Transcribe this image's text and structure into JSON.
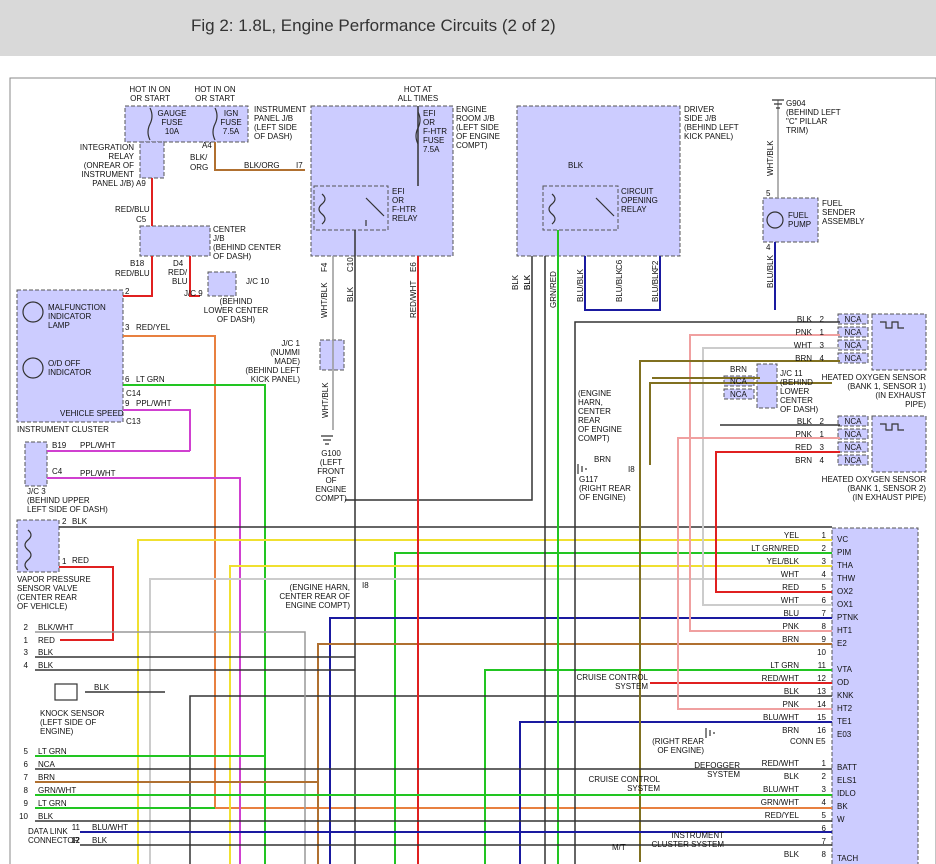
{
  "header": {
    "title": "Fig 2: 1.8L, Engine Performance Circuits (2 of 2)"
  },
  "labels": [
    [
      "HOT IN ON OR START",
      "HOT IN ON OR START",
      "GAUGE FUSE 10A",
      "IGN FUSE 7.5A",
      "INSTRUMENT PANEL J/B (LEFT SIDE OF DASH)"
    ]
  ],
  "texts": {
    "hot_on_start_1": [
      "HOT IN ON",
      "OR START"
    ],
    "hot_on_start_2": [
      "HOT IN ON",
      "OR START"
    ],
    "gauge_fuse": [
      "GAUGE",
      "FUSE",
      "10A"
    ],
    "ign_fuse": [
      "IGN",
      "FUSE",
      "7.5A"
    ],
    "ipjb": [
      "INSTRUMENT",
      "PANEL J/B",
      "(LEFT SIDE",
      "OF DASH)"
    ],
    "hot_all_times": [
      "HOT AT",
      "ALL TIMES"
    ],
    "efi_fuse": [
      "EFI",
      "OR",
      "F-HTR",
      "FUSE",
      "7.5A"
    ],
    "erjb": [
      "ENGINE",
      "ROOM J/B",
      "(LEFT SIDE",
      "OF ENGINE",
      "COMPT)"
    ],
    "dsjb": [
      "DRIVER",
      "SIDE J/B",
      "(BEHIND LEFT",
      "KICK PANEL)"
    ],
    "g904": [
      "G904",
      "(BEHIND LEFT",
      "\"C\" PILLAR",
      "TRIM)"
    ],
    "integration_relay": [
      "INTEGRATION",
      "RELAY",
      "(ONREAR OF",
      "INSTRUMENT",
      "PANEL J/B)"
    ],
    "center_jb": [
      "CENTER",
      "J/B",
      "(BEHIND CENTER",
      "OF DASH)"
    ],
    "jc9": [
      "(BEHIND",
      "LOWER CENTER",
      "OF DASH)"
    ],
    "efi_relay": [
      "EFI",
      "OR",
      "F-HTR",
      "RELAY"
    ],
    "cor_relay": [
      "CIRCUIT",
      "OPENING",
      "RELAY"
    ],
    "fuel_pump": [
      "FUEL",
      "PUMP"
    ],
    "fuel_sender": [
      "FUEL",
      "SENDER",
      "ASSEMBLY"
    ],
    "malfunction_lamp": [
      "MALFUNCTION",
      "INDICATOR",
      "LAMP"
    ],
    "od_off": [
      "O/D OFF",
      "INDICATOR"
    ],
    "jc1": [
      "J/C 1",
      "(NUMMI",
      "MADE)",
      "(BEHIND LEFT",
      "KICK PANEL)"
    ],
    "g100": [
      "G100",
      "(LEFT",
      "FRONT",
      "OF",
      "ENGINE",
      "COMPT)"
    ],
    "engine_harn_1": [
      "(ENGINE",
      "HARN,",
      "CENTER",
      "REAR",
      "OF ENGINE",
      "COMPT)"
    ],
    "g117_1": [
      "G117",
      "(RIGHT REAR",
      "OF ENGINE)"
    ],
    "jc11": [
      "J/C 11",
      "(BEHIND",
      "LOWER",
      "CENTER",
      "OF DASH)"
    ],
    "ho2s_1": [
      "HEATED OXYGEN SENSOR",
      "(BANK 1, SENSOR 1)",
      "(IN EXHAUST",
      "PIPE)"
    ],
    "ho2s_2": [
      "HEATED OXYGEN SENSOR",
      "(BANK 1, SENSOR 2)",
      "(IN EXHAUST PIPE)"
    ],
    "jc3": [
      "J/C 3",
      "(BEHIND UPPER",
      "LEFT SIDE OF DASH)"
    ],
    "vpsv": [
      "VAPOR PRESSURE",
      "SENSOR VALVE",
      "(CENTER REAR",
      "OF VEHICLE)"
    ],
    "engine_harn_2": [
      "(ENGINE HARN,",
      "CENTER REAR OF",
      "ENGINE COMPT)"
    ],
    "knock_sensor": [
      "KNOCK SENSOR",
      "(LEFT SIDE OF",
      "ENGINE)"
    ],
    "cruise_1": [
      "CRUISE CONTROL",
      "SYSTEM"
    ],
    "g117_2": [
      "(RIGHT REAR",
      "OF ENGINE)"
    ],
    "defogger": [
      "DEFOGGER",
      "SYSTEM"
    ],
    "cruise_2": [
      "CRUISE CONTROL",
      "SYSTEM"
    ],
    "inst_cluster_sys": [
      "INSTRUMENT",
      "CLUSTER SYSTEM"
    ],
    "dlc": [
      "DATA LINK",
      "CONNECTOR"
    ]
  },
  "single": {
    "instrument_cluster": "INSTRUMENT CLUSTER",
    "vehicle_speed": "VEHICLE SPEED",
    "jc9_name": "J/C 9",
    "jc10_name": "J/C 10",
    "g117_top": "G117",
    "mt": "M/T",
    "i8": "I8",
    "i8b": "I8",
    "i7": "I7",
    "conn_e5": "CONN E5"
  },
  "ecm_pins": [
    {
      "wire": "YEL",
      "num": "1",
      "name": "VC"
    },
    {
      "wire": "LT GRN/RED",
      "num": "2",
      "name": "PIM"
    },
    {
      "wire": "YEL/BLK",
      "num": "3",
      "name": "THA"
    },
    {
      "wire": "WHT",
      "num": "4",
      "name": "THW"
    },
    {
      "wire": "RED",
      "num": "5",
      "name": "OX2"
    },
    {
      "wire": "WHT",
      "num": "6",
      "name": "OX1"
    },
    {
      "wire": "BLU",
      "num": "7",
      "name": "PTNK"
    },
    {
      "wire": "PNK",
      "num": "8",
      "name": "HT1"
    },
    {
      "wire": "BRN",
      "num": "9",
      "name": "E2"
    },
    {
      "wire": "",
      "num": "10",
      "name": ""
    },
    {
      "wire": "LT GRN",
      "num": "11",
      "name": "VTA"
    },
    {
      "wire": "RED/WHT",
      "num": "12",
      "name": "OD"
    },
    {
      "wire": "BLK",
      "num": "13",
      "name": "KNK"
    },
    {
      "wire": "PNK",
      "num": "14",
      "name": "HT2"
    },
    {
      "wire": "BLU/WHT",
      "num": "15",
      "name": "TE1"
    },
    {
      "wire": "BRN",
      "num": "16",
      "name": "E03"
    },
    {
      "wire": "RED/WHT",
      "num": "1",
      "name": "BATT"
    },
    {
      "wire": "BLK",
      "num": "2",
      "name": "ELS1"
    },
    {
      "wire": "BLU/WHT",
      "num": "3",
      "name": "IDLO"
    },
    {
      "wire": "GRN/WHT",
      "num": "4",
      "name": "BK"
    },
    {
      "wire": "RED/YEL",
      "num": "5",
      "name": "W"
    },
    {
      "wire": "",
      "num": "6",
      "name": ""
    },
    {
      "wire": "",
      "num": "7",
      "name": ""
    },
    {
      "wire": "BLK",
      "num": "8",
      "name": "TACH"
    }
  ],
  "ho2s1_pins": [
    {
      "wire": "BLK",
      "num": "2",
      "nca": "NCA"
    },
    {
      "wire": "PNK",
      "num": "1",
      "nca": "NCA"
    },
    {
      "wire": "WHT",
      "num": "3",
      "nca": "NCA"
    },
    {
      "wire": "BRN",
      "num": "4",
      "nca": "NCA"
    }
  ],
  "ho2s2_pins": [
    {
      "wire": "BLK",
      "num": "2",
      "nca": "NCA"
    },
    {
      "wire": "PNK",
      "num": "1",
      "nca": "NCA"
    },
    {
      "wire": "RED",
      "num": "3",
      "nca": "NCA"
    },
    {
      "wire": "BRN",
      "num": "4",
      "nca": "NCA"
    }
  ],
  "dlc_pins": [
    {
      "num": "2",
      "wire": "BLK/WHT"
    },
    {
      "num": "1",
      "wire": "RED"
    },
    {
      "num": "3",
      "wire": "BLK"
    },
    {
      "num": "4",
      "wire": "BLK"
    },
    {
      "num": "5",
      "wire": "LT GRN"
    },
    {
      "num": "6",
      "wire": "NCA"
    },
    {
      "num": "7",
      "wire": "BRN"
    },
    {
      "num": "8",
      "wire": "GRN/WHT"
    },
    {
      "num": "9",
      "wire": "LT GRN"
    },
    {
      "num": "10",
      "wire": "BLK"
    },
    {
      "num": "11",
      "wire": "BLU/WHT"
    },
    {
      "num": "12",
      "wire": "BLK"
    }
  ],
  "wire_labels": {
    "blk_org_1": "BLK/",
    "blk_org_1b": "ORG",
    "blk_org_2": "BLK/ORG",
    "a4": "A4",
    "a9": "A9",
    "c5": "C5",
    "red_blu_1": "RED/BLU",
    "red_blu_2": "RED/BLU",
    "b18": "B18",
    "d4": "D4",
    "red_blu_3": "RED/",
    "red_blu_3b": "BLU",
    "pin2": "2",
    "pin3": "3",
    "red_yel": "RED/YEL",
    "pin6": "6",
    "lt_grn": "LT GRN",
    "c14": "C14",
    "pin9": "9",
    "ppl_wht_1": "PPL/WHT",
    "c13": "C13",
    "b19": "B19",
    "ppl_wht_2": "PPL/WHT",
    "c4": "C4",
    "ppl_wht_3": "PPL/WHT",
    "vp2": "2",
    "vp_blk": "BLK",
    "vp1": "1",
    "vp_red": "RED",
    "ks_blk": "BLK",
    "wht_blk_f4": "WHT/BLK",
    "f4": "F4",
    "blk_c10": "BLK",
    "c10": "C10",
    "red_wht_e6": "RED/WHT",
    "e6": "E6",
    "wht_blk_jc1": "WHT/BLK",
    "blk_cor": "BLK",
    "blk_1": "BLK",
    "blk_2": "BLK",
    "grn_red": "GRN/RED",
    "blk_3": "BLK",
    "blu_blk_1": "BLU/BLK",
    "blu_blk_2": "BLU/BLK",
    "c6": "C6",
    "blu_blk_3": "BLU/BLK",
    "f2": "F2",
    "blu_blk_4": "BLU/BLK",
    "wht_blk_fp": "WHT/BLK",
    "fp5": "5",
    "fp4": "4",
    "jc11_brn": "BRN",
    "jc11_nca1": "NCA",
    "jc11_nca2": "NCA",
    "g117_brn": "BRN",
    "g117_e3": "E03"
  },
  "colors": {
    "fill": "#ccccff",
    "border": "#555555",
    "wire_red": "#e02020",
    "wire_blue": "#1a1aa0",
    "wire_green": "#22c522",
    "wire_yellow": "#f0e030",
    "wire_pink": "#f0a0a0",
    "wire_purple": "#d040d0",
    "wire_brown": "#b07030",
    "wire_olive": "#807020",
    "wire_gray": "#aaaaaa"
  }
}
